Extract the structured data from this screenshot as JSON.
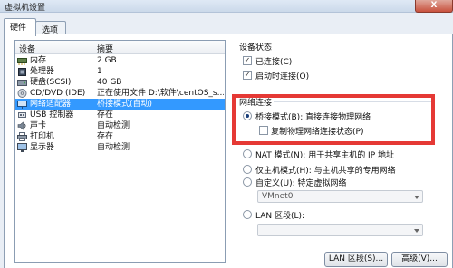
{
  "window": {
    "title": "虚拟机设置",
    "close_label": "X"
  },
  "tabs": [
    {
      "label": "硬件"
    },
    {
      "label": "选项"
    }
  ],
  "device_list": {
    "headers": {
      "device": "设备",
      "summary": "摘要"
    },
    "rows": [
      {
        "device": "内存",
        "summary": "2 GB",
        "icon": "memory-icon"
      },
      {
        "device": "处理器",
        "summary": "1",
        "icon": "processor-icon"
      },
      {
        "device": "硬盘(SCSI)",
        "summary": "40 GB",
        "icon": "hard-disk-icon"
      },
      {
        "device": "CD/DVD (IDE)",
        "summary": "正在使用文件 D:\\软件\\centOS_s...",
        "icon": "cd-dvd-icon"
      },
      {
        "device": "网络适配器",
        "summary": "桥接模式(自动)",
        "icon": "network-adapter-icon",
        "selected": true
      },
      {
        "device": "USB 控制器",
        "summary": "存在",
        "icon": "usb-icon"
      },
      {
        "device": "声卡",
        "summary": "自动检测",
        "icon": "sound-card-icon"
      },
      {
        "device": "打印机",
        "summary": "存在",
        "icon": "printer-icon"
      },
      {
        "device": "显示器",
        "summary": "自动检测",
        "icon": "monitor-icon"
      }
    ]
  },
  "device_status": {
    "group_label": "设备状态",
    "connected": {
      "label": "已连接(C)",
      "checked": true
    },
    "connect_on_power": {
      "label": "启动时连接(O)",
      "checked": true
    }
  },
  "network_connection": {
    "group_label": "网络连接",
    "bridged": {
      "label": "桥接模式(B): 直接连接物理网络",
      "selected": true
    },
    "replicate": {
      "label": "复制物理网络连接状态(P)",
      "checked": false
    },
    "nat": {
      "label": "NAT 模式(N): 用于共享主机的 IP 地址"
    },
    "host_only": {
      "label": "仅主机模式(H): 与主机共享的专用网络"
    },
    "custom": {
      "label": "自定义(U): 特定虚拟网络"
    },
    "vmnet_select": {
      "value": "VMnet0"
    },
    "lan_segment": {
      "label": "LAN 区段(L):"
    },
    "lan_select": {
      "value": ""
    }
  },
  "buttons": {
    "lan_segments": "LAN 区段(S)...",
    "advanced": "高级(V)..."
  },
  "colors": {
    "selection": "#3399ff",
    "highlight_box": "#e53935"
  }
}
